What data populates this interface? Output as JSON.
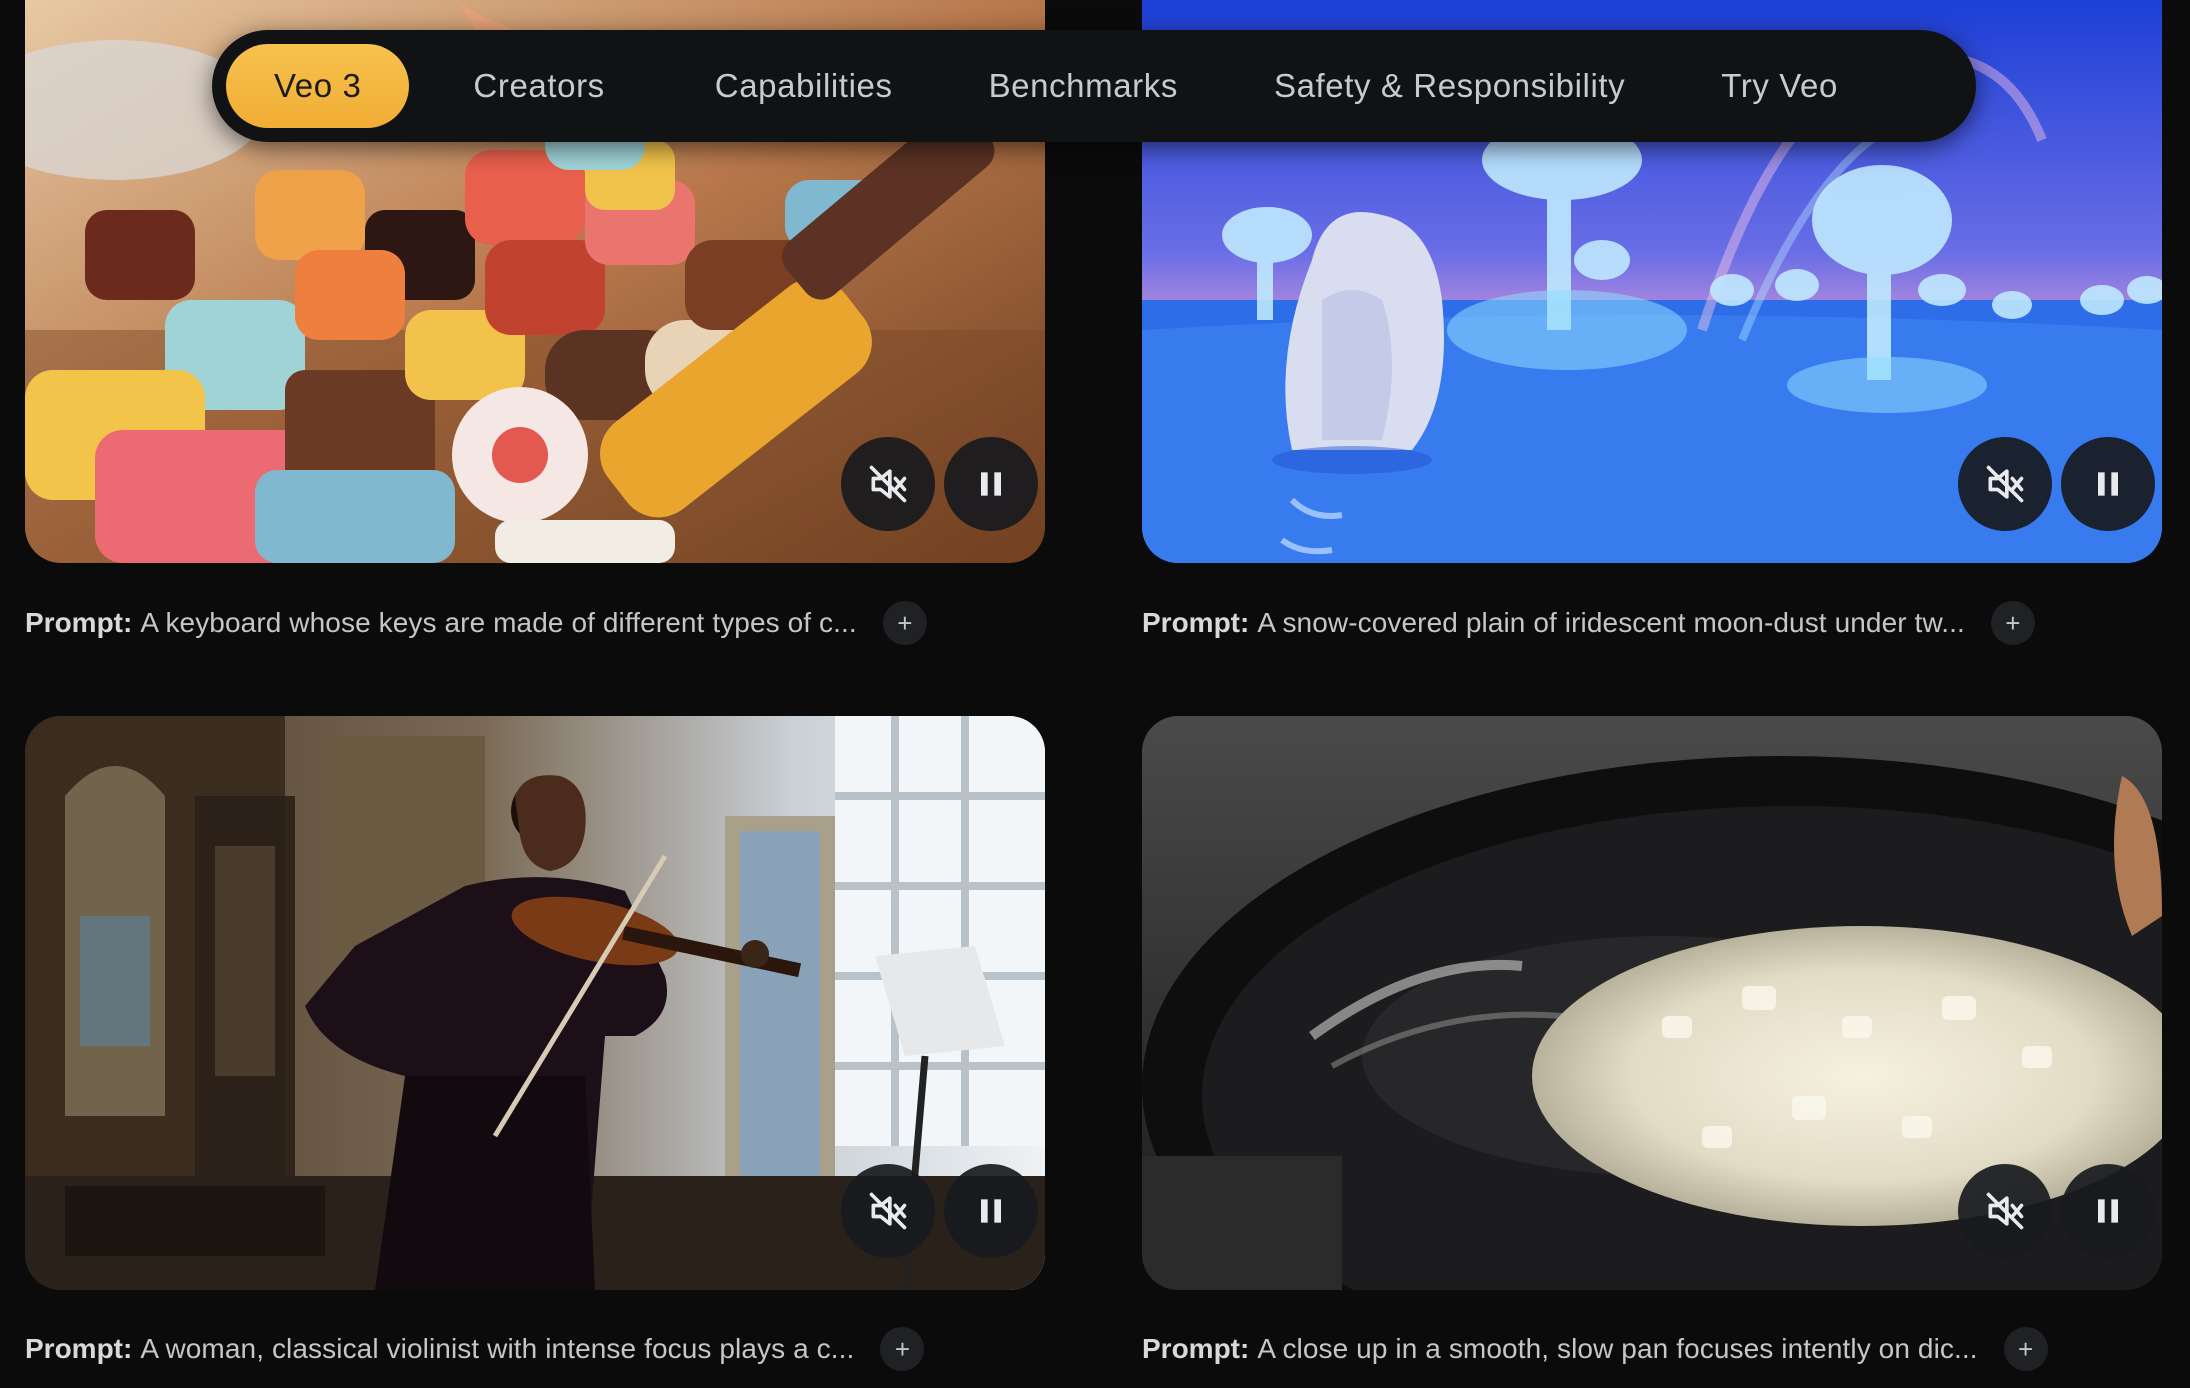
{
  "nav": {
    "items": [
      {
        "label": "Veo 3",
        "active": true
      },
      {
        "label": "Creators",
        "active": false
      },
      {
        "label": "Capabilities",
        "active": false
      },
      {
        "label": "Benchmarks",
        "active": false
      },
      {
        "label": "Safety & Responsibility",
        "active": false
      },
      {
        "label": "Try Veo",
        "active": false
      }
    ],
    "accent_color": "#f3b63f"
  },
  "cards": [
    {
      "prompt_label": "Prompt:",
      "prompt_text": "A keyboard whose keys are made of different types of c...",
      "expand_label": "+",
      "mute_icon": "volume-off-icon",
      "pause_icon": "pause-icon"
    },
    {
      "prompt_label": "Prompt:",
      "prompt_text": "A snow-covered plain of iridescent moon-dust under tw...",
      "expand_label": "+",
      "mute_icon": "volume-off-icon",
      "pause_icon": "pause-icon"
    },
    {
      "prompt_label": "Prompt:",
      "prompt_text": "A woman, classical violinist with intense focus plays a c...",
      "expand_label": "+",
      "mute_icon": "volume-off-icon",
      "pause_icon": "pause-icon"
    },
    {
      "prompt_label": "Prompt:",
      "prompt_text": "A close up in a smooth, slow pan focuses intently on dic...",
      "expand_label": "+",
      "mute_icon": "volume-off-icon",
      "pause_icon": "pause-icon"
    }
  ]
}
